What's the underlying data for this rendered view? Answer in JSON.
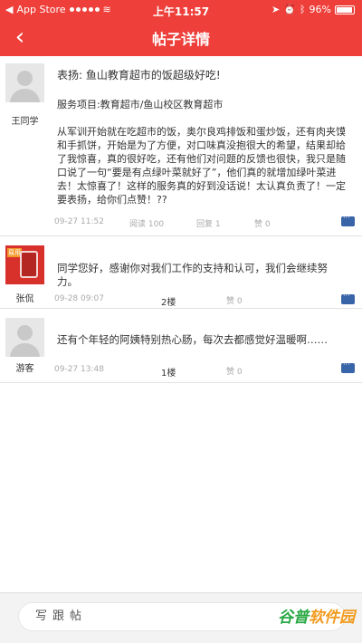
{
  "status": {
    "carrier": "App Store",
    "time": "上午11:57",
    "battery": "96%"
  },
  "nav": {
    "back_icon": "chevron-left-icon",
    "title": "帖子详情"
  },
  "posts": [
    {
      "author": "王同学",
      "title": "表扬: 鱼山教育超市的饭超级好吃!",
      "project": "服务项目:教育超市/鱼山校区教育超市",
      "body": "从军训开始就在吃超市的饭，奥尔良鸡排饭和蛋炒饭，还有肉夹馍和手抓饼，开始是为了方便，对口味真没抱很大的希望，结果却给了我惊喜，真的很好吃，还有他们对问题的反馈也很快，我只是随口说了一句“要是有点绿叶菜就好了”，他们真的就增加绿叶菜进去！太惊喜了！这样的服务真的好到没话说！太认真负责了！一定要表扬，给你们点赞！??",
      "date": "09-27 11:52",
      "read": "阅读 100",
      "reply": "回复 1",
      "like": "赞 0"
    },
    {
      "author": "张侃",
      "body": "同学您好，感谢你对我们工作的支持和认可，我们会继续努力。",
      "date": "09-28 09:07",
      "floor": "2楼",
      "like": "赞 0"
    },
    {
      "author": "游客",
      "body": "还有个年轻的阿姨特别热心肠，每次去都感觉好温暖啊……",
      "date": "09-27 13:48",
      "floor": "1楼",
      "like": "赞 0"
    }
  ],
  "footer": {
    "reply_placeholder": "写跟帖",
    "watermark_a": "谷普",
    "watermark_b": "软件园"
  }
}
